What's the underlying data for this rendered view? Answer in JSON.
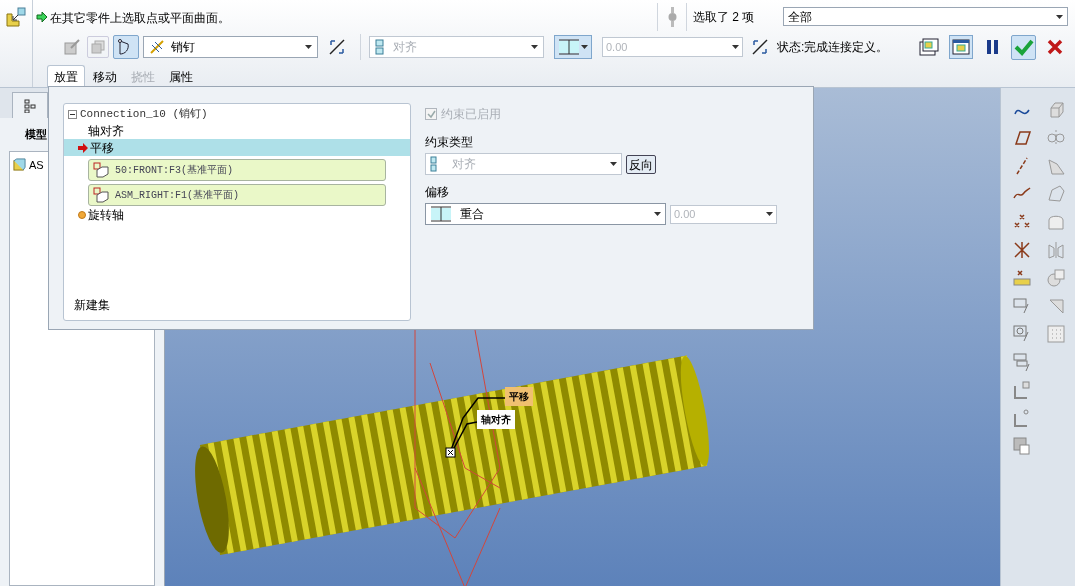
{
  "prompt": {
    "message": "在其它零件上选取点或平面曲面。"
  },
  "selection": {
    "count_label": "选取了 2 项",
    "filter": "全部"
  },
  "toolbar": {
    "connection_type": "销钉",
    "constraint_type": "对齐",
    "offset_value": "0.00",
    "status": "状态:完成连接定义。"
  },
  "tabs": [
    {
      "label": "放置",
      "selected": true,
      "disabled": false
    },
    {
      "label": "移动",
      "selected": false,
      "disabled": false
    },
    {
      "label": "挠性",
      "selected": false,
      "disabled": true
    },
    {
      "label": "属性",
      "selected": false,
      "disabled": false
    }
  ],
  "model_tree": {
    "title": "模型",
    "items": [
      {
        "label": "AS"
      }
    ]
  },
  "placement": {
    "sets": [
      {
        "label": "Connection_10 (销钉)",
        "expanded": true,
        "children": [
          {
            "label": "轴对齐",
            "kind": "constraint",
            "selected": false
          },
          {
            "label": "平移",
            "kind": "constraint",
            "selected": true,
            "children": [
              {
                "label": "50:FRONT:F3(基准平面)"
              },
              {
                "label": "ASM_RIGHT:F1(基准平面)"
              }
            ]
          },
          {
            "label": "旋转轴",
            "kind": "axis",
            "selected": false
          }
        ]
      }
    ],
    "new_set": "新建集",
    "enabled_checkbox": {
      "label": "约束已启用",
      "checked": true,
      "disabled": true
    },
    "constraint_type": {
      "label": "约束类型",
      "value": "对齐",
      "disabled": true
    },
    "flip_button": "反向",
    "offset": {
      "label": "偏移",
      "value": "重合",
      "amount": "0.00"
    }
  },
  "viewport": {
    "callouts": [
      {
        "label": "平移",
        "kind": "highlight"
      },
      {
        "label": "轴对齐",
        "kind": "plain"
      }
    ]
  }
}
